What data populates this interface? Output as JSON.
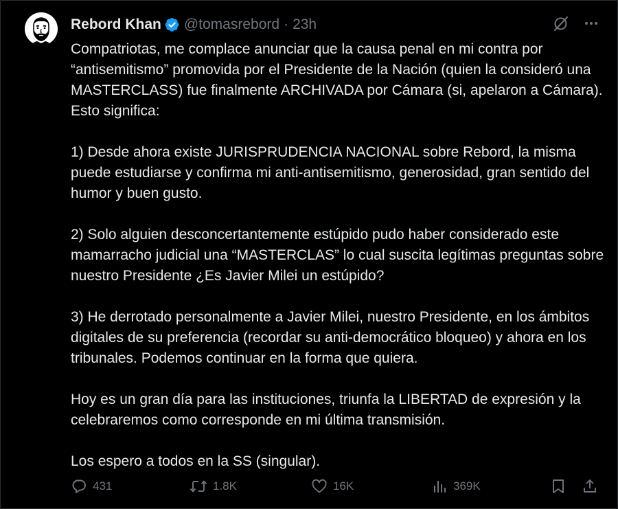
{
  "tweet": {
    "author": {
      "display_name": "Rebord Khan",
      "handle": "@tomasrebord",
      "separator": "·",
      "time": "23h",
      "verified": true,
      "avatar_icon": "bearded-man-avatar"
    },
    "paragraphs": [
      "Compatriotas, me complace anunciar que la causa penal en mi contra por “antisemitismo” promovida por el Presidente de la Nación (quien la consideró una MASTERCLASS) fue finalmente ARCHIVADA por Cámara (si, apelaron a Cámara). Esto significa:",
      "1) Desde ahora existe JURISPRUDENCIA NACIONAL sobre Rebord, la misma puede estudiarse y confirma mi anti-antisemitismo, generosidad, gran sentido del humor y buen gusto.",
      "2) Solo alguien desconcertantemente estúpido pudo haber considerado este mamarracho judicial una “MASTERCLAS” lo cual suscita legítimas preguntas sobre nuestro Presidente ¿Es Javier Milei un estúpido?",
      "3) He derrotado personalmente a Javier Milei, nuestro Presidente, en los ámbitos digitales de su preferencia (recordar su anti-democrático bloqueo) y ahora en los tribunales. Podemos continuar en la forma que quiera.",
      "Hoy es un gran día para las instituciones, triunfa la LIBERTAD de expresión y la celebraremos como corresponde en mi última transmisión.",
      "Los espero a todos en la SS (singular)."
    ],
    "stats": {
      "replies": "431",
      "retweets": "1.8K",
      "likes": "16K",
      "views": "369K"
    }
  },
  "icons": {
    "verified": "verified-badge-icon",
    "grok": "grok-icon",
    "more": "more-icon",
    "reply": "reply-icon",
    "retweet": "retweet-icon",
    "like": "heart-icon",
    "views": "views-icon",
    "bookmark": "bookmark-icon",
    "share": "share-icon"
  },
  "colors": {
    "background": "#000000",
    "text": "#e7e9ea",
    "muted": "#71767b",
    "verified": "#1d9bf0"
  }
}
